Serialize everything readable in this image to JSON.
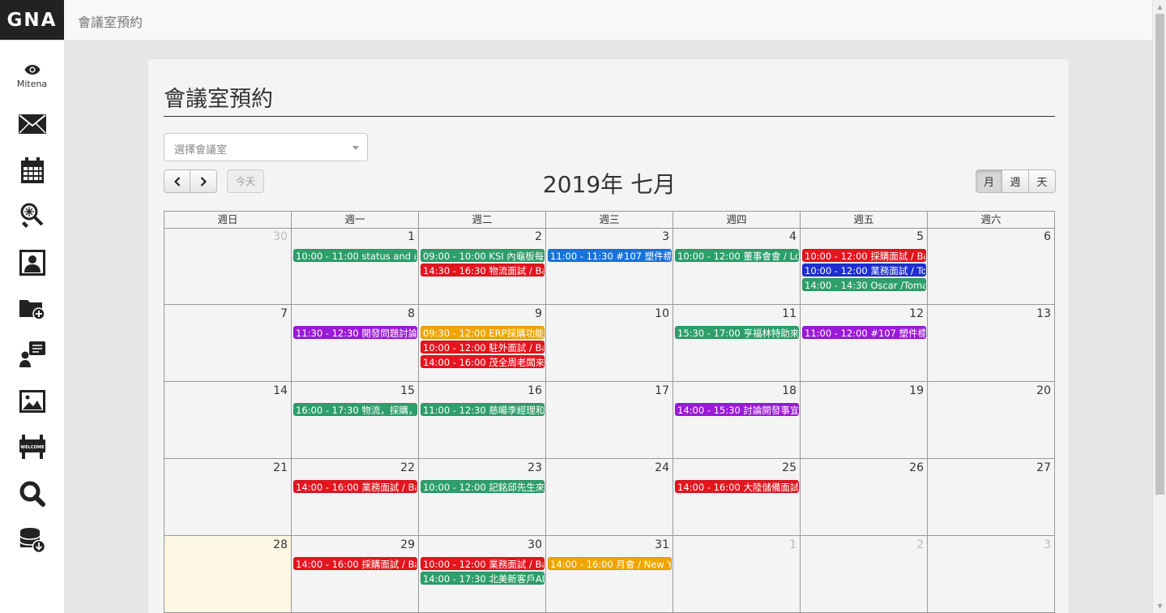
{
  "header": {
    "brand": "GNA",
    "title": "會議室預約"
  },
  "sidebar": {
    "mitena_label": "Mitena",
    "items": [
      {
        "name": "eye-icon"
      },
      {
        "name": "mail-icon"
      },
      {
        "name": "calendar-icon"
      },
      {
        "name": "badminton-icon"
      },
      {
        "name": "contact-icon"
      },
      {
        "name": "folder-add-icon"
      },
      {
        "name": "chat-icon"
      },
      {
        "name": "image-icon"
      },
      {
        "name": "welcome-sign-icon"
      },
      {
        "name": "search-icon"
      },
      {
        "name": "database-download-icon"
      }
    ]
  },
  "main": {
    "page_title": "會議室預約",
    "room_select_placeholder": "選擇會議室",
    "nav": {
      "prev": "‹",
      "next": "›",
      "today": "今天"
    },
    "views": [
      "月",
      "週",
      "天"
    ],
    "calendar_title": "2019年 七月"
  },
  "colors": {
    "green": "#2e9e6b",
    "red": "#e4151f",
    "blue": "#1a72db",
    "purple": "#9b19d8",
    "orange": "#f0a500",
    "navy": "#1d2fd1"
  },
  "calendar": {
    "weekdays": [
      "週日",
      "週一",
      "週二",
      "週三",
      "週四",
      "週五",
      "週六"
    ],
    "weeks": [
      [
        {
          "num": "30",
          "other": true,
          "events": []
        },
        {
          "num": "1",
          "events": [
            {
              "time": "10:00 - 11:00",
              "title": "status and ac",
              "color": "#2e9e6b"
            }
          ]
        },
        {
          "num": "2",
          "events": [
            {
              "time": "09:00 - 10:00",
              "title": "KSI 內龜板每",
              "color": "#2e9e6b"
            },
            {
              "time": "14:30 - 16:30",
              "title": "物流面試 / Ba",
              "color": "#e4151f"
            }
          ]
        },
        {
          "num": "3",
          "events": [
            {
              "time": "11:00 - 11:30",
              "title": "#107 塑件標!",
              "color": "#1a72db"
            }
          ]
        },
        {
          "num": "4",
          "events": [
            {
              "time": "10:00 - 12:00",
              "title": "董事會會 / Lo",
              "color": "#2e9e6b"
            }
          ]
        },
        {
          "num": "5",
          "events": [
            {
              "time": "10:00 - 12:00",
              "title": "採購面試 / Ba",
              "color": "#e4151f"
            },
            {
              "time": "10:00 - 12:00",
              "title": "業務面試 / To",
              "color": "#1d2fd1"
            },
            {
              "time": "14:00 - 14:30",
              "title": "Oscar /Toma",
              "color": "#2e9e6b"
            }
          ]
        },
        {
          "num": "6",
          "events": []
        }
      ],
      [
        {
          "num": "7",
          "events": []
        },
        {
          "num": "8",
          "events": [
            {
              "time": "11:30 - 12:30",
              "title": "開發問題討論",
              "color": "#9b19d8"
            }
          ]
        },
        {
          "num": "9",
          "events": [
            {
              "time": "09:30 - 12:00",
              "title": "ERP採購功能",
              "color": "#f0a500"
            },
            {
              "time": "10:00 - 12:00",
              "title": "駐外面試 / Ba",
              "color": "#e4151f"
            },
            {
              "time": "14:00 - 16:00",
              "title": "茂全周老闆來",
              "color": "#e4151f"
            }
          ]
        },
        {
          "num": "10",
          "events": []
        },
        {
          "num": "11",
          "events": [
            {
              "time": "15:30 - 17:00",
              "title": "亨福林特助來",
              "color": "#2e9e6b"
            }
          ]
        },
        {
          "num": "12",
          "events": [
            {
              "time": "11:00 - 12:00",
              "title": "#107 塑件標!",
              "color": "#9b19d8"
            }
          ]
        },
        {
          "num": "13",
          "events": []
        }
      ],
      [
        {
          "num": "14",
          "events": []
        },
        {
          "num": "15",
          "events": [
            {
              "time": "16:00 - 17:30",
              "title": "物流，採購，",
              "color": "#2e9e6b"
            }
          ]
        },
        {
          "num": "16",
          "events": [
            {
              "time": "11:00 - 12:30",
              "title": "慈暘李經理和",
              "color": "#2e9e6b"
            }
          ]
        },
        {
          "num": "17",
          "events": []
        },
        {
          "num": "18",
          "events": [
            {
              "time": "14:00 - 15:30",
              "title": "討論開發事宜",
              "color": "#9b19d8"
            }
          ]
        },
        {
          "num": "19",
          "events": []
        },
        {
          "num": "20",
          "events": []
        }
      ],
      [
        {
          "num": "21",
          "events": []
        },
        {
          "num": "22",
          "events": [
            {
              "time": "14:00 - 16:00",
              "title": "業務面試 / Ba",
              "color": "#e4151f"
            }
          ]
        },
        {
          "num": "23",
          "events": [
            {
              "time": "10:00 - 12:00",
              "title": "記銘邱先生來",
              "color": "#2e9e6b"
            }
          ]
        },
        {
          "num": "24",
          "events": []
        },
        {
          "num": "25",
          "events": [
            {
              "time": "14:00 - 16:00",
              "title": "大陸儲備面試",
              "color": "#e4151f"
            }
          ]
        },
        {
          "num": "26",
          "events": []
        },
        {
          "num": "27",
          "events": []
        }
      ],
      [
        {
          "num": "28",
          "today": true,
          "events": []
        },
        {
          "num": "29",
          "events": [
            {
              "time": "14:00 - 16:00",
              "title": "採購面試 / Ba",
              "color": "#e4151f"
            }
          ]
        },
        {
          "num": "30",
          "events": [
            {
              "time": "10:00 - 12:00",
              "title": "業務面試 / Ba",
              "color": "#e4151f"
            },
            {
              "time": "14:00 - 17:30",
              "title": "北美新客戶AI",
              "color": "#2e9e6b"
            }
          ]
        },
        {
          "num": "31",
          "events": [
            {
              "time": "14:00 - 16:00",
              "title": "月會 / New Y",
              "color": "#f0a500"
            }
          ]
        },
        {
          "num": "1",
          "other": true,
          "events": []
        },
        {
          "num": "2",
          "other": true,
          "events": []
        },
        {
          "num": "3",
          "other": true,
          "events": []
        }
      ]
    ]
  }
}
